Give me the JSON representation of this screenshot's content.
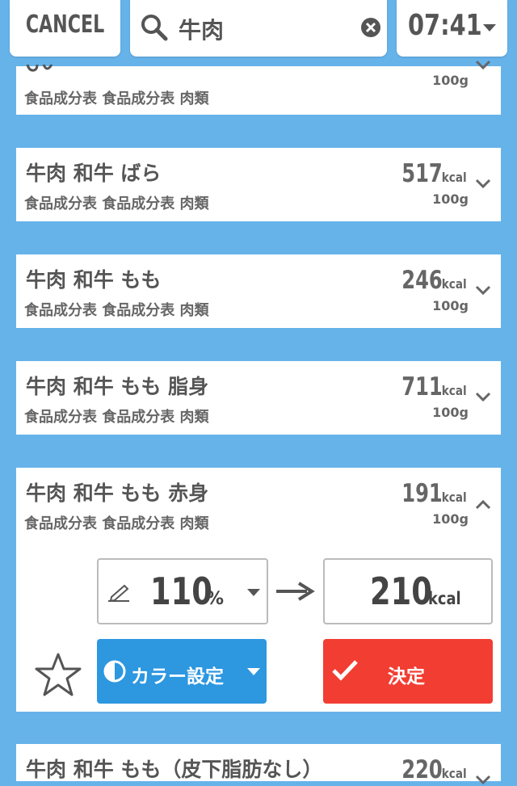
{
  "topbar": {
    "cancel_label": "CANCEL",
    "search_query": "牛肉",
    "time": "07:41"
  },
  "items": [
    {
      "title": "",
      "kcal": "",
      "unit": "",
      "serving": "100g",
      "source": "食品成分表 食品成分表 肉類"
    },
    {
      "title": "牛肉 和牛 ばら",
      "kcal": "517",
      "unit": "kcal",
      "serving": "100g",
      "source": "食品成分表 食品成分表 肉類"
    },
    {
      "title": "牛肉 和牛 もも",
      "kcal": "246",
      "unit": "kcal",
      "serving": "100g",
      "source": "食品成分表 食品成分表 肉類"
    },
    {
      "title": "牛肉 和牛 もも 脂身",
      "kcal": "711",
      "unit": "kcal",
      "serving": "100g",
      "source": "食品成分表 食品成分表 肉類"
    },
    {
      "title": "牛肉 和牛 もも 赤身",
      "kcal": "191",
      "unit": "kcal",
      "serving": "100g",
      "source": "食品成分表 食品成分表 肉類"
    },
    {
      "title": "牛肉 和牛 もも（皮下脂肪なし）",
      "kcal": "220",
      "unit": "kcal",
      "serving": "",
      "source": ""
    }
  ],
  "expanded": {
    "percent_value": "110",
    "percent_unit": "%",
    "result_value": "210",
    "result_unit": "kcal",
    "color_button_label": "カラー設定",
    "confirm_button_label": "決定"
  },
  "colors": {
    "background": "#66b3ea",
    "color_button": "#2d97e0",
    "confirm_button": "#f23d33"
  }
}
